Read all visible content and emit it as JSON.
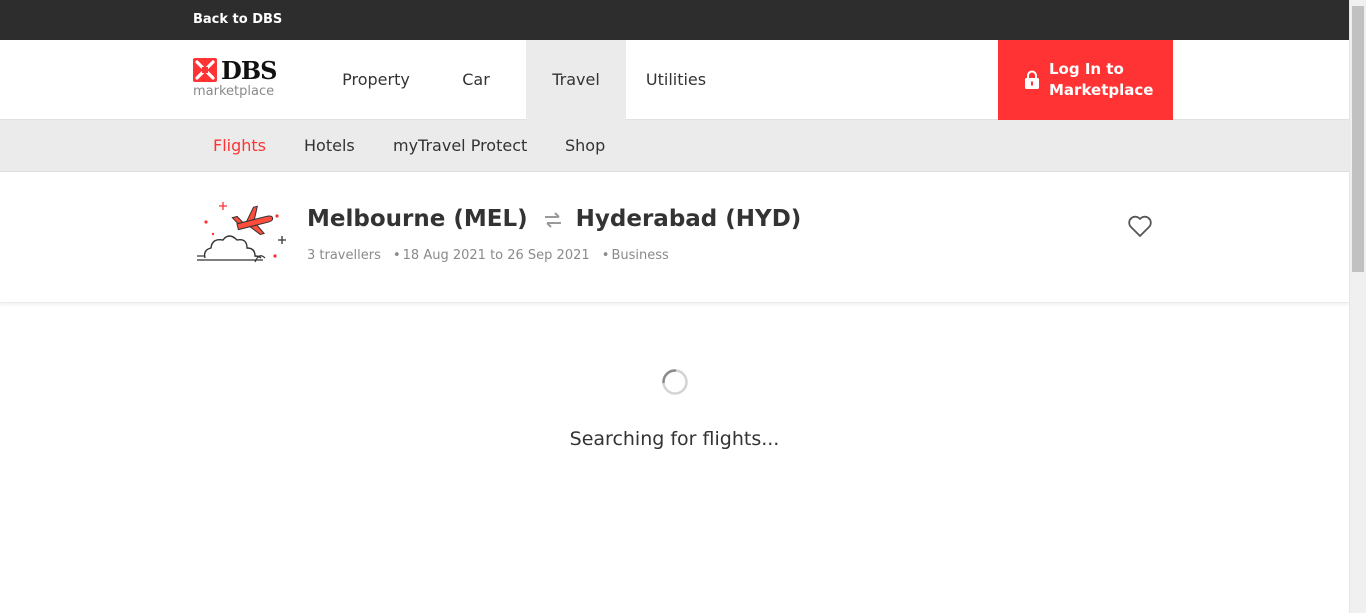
{
  "topbar": {
    "back_label": "Back to DBS"
  },
  "brand": {
    "name": "DBS",
    "sub": "marketplace",
    "color": "#ff3333"
  },
  "nav": {
    "items": [
      {
        "label": "Property"
      },
      {
        "label": "Car"
      },
      {
        "label": "Travel",
        "active": true
      },
      {
        "label": "Utilities"
      }
    ],
    "login_label": "Log In to Marketplace"
  },
  "subnav": {
    "items": [
      {
        "label": "Flights",
        "active": true
      },
      {
        "label": "Hotels"
      },
      {
        "label": "myTravel Protect"
      },
      {
        "label": "Shop"
      }
    ]
  },
  "search": {
    "origin": "Melbourne (MEL)",
    "destination": "Hyderabad (HYD)",
    "travellers": "3 travellers",
    "dates": "18 Aug 2021 to 26 Sep 2021",
    "cabin": "Business",
    "separator": "•"
  },
  "status": {
    "loading_text": "Searching for flights..."
  },
  "icons": {
    "logo": "dbs-logo-icon",
    "lock": "lock-icon",
    "plane": "airplane-illustration",
    "swap": "swap-arrows-icon",
    "favorite": "heart-icon",
    "spinner": "loading-spinner-icon"
  }
}
